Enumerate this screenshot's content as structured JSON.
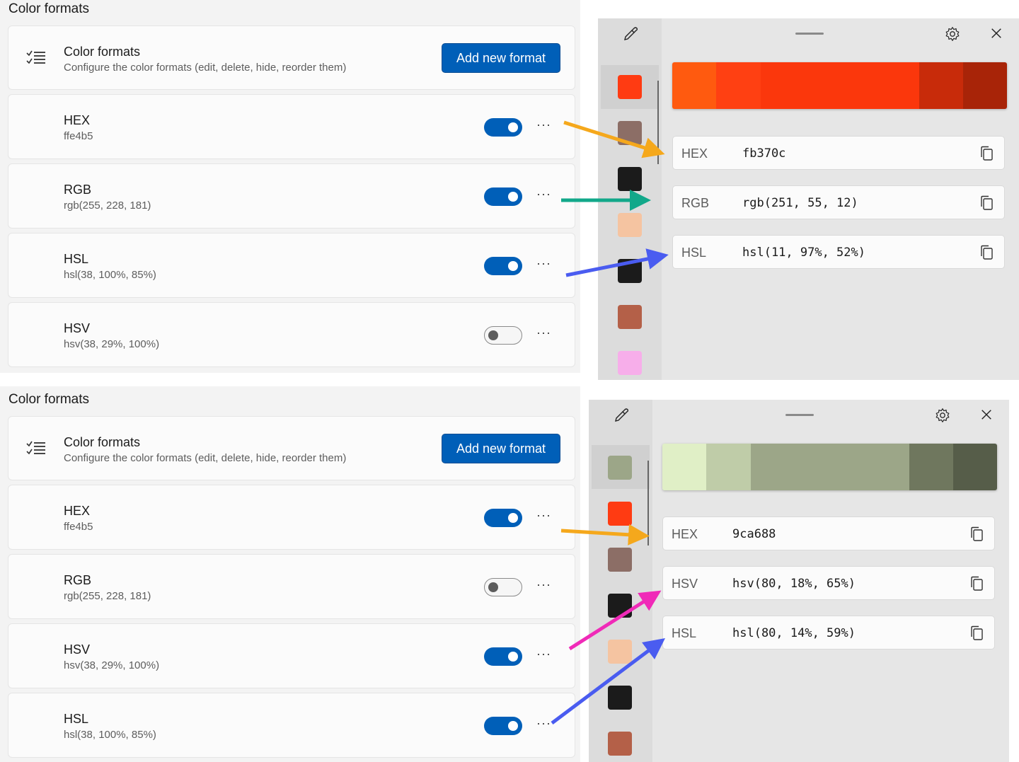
{
  "top": {
    "panel_title": "Color formats",
    "header": {
      "title": "Color formats",
      "subtitle": "Configure the color formats (edit, delete, hide, reorder them)",
      "add_button": "Add new format"
    },
    "formats": [
      {
        "name": "HEX",
        "value": "ffe4b5",
        "enabled": true
      },
      {
        "name": "RGB",
        "value": "rgb(255, 228, 181)",
        "enabled": true
      },
      {
        "name": "HSL",
        "value": "hsl(38, 100%, 85%)",
        "enabled": true
      },
      {
        "name": "HSV",
        "value": "hsv(38, 29%, 100%)",
        "enabled": false
      }
    ],
    "more_label": "···",
    "picker": {
      "history_colors": [
        "#ff3b12",
        "#8c6e66",
        "#1b1b1b",
        "#f5c4a1",
        "#1b1b1b",
        "#b46048",
        "#f7aeea"
      ],
      "gradient": [
        "#ff5a0f",
        "#ff4012",
        "#fb370c",
        "#fb370c",
        "#fb370c",
        "#c82b0a",
        "#a82408"
      ],
      "rows": [
        {
          "name": "HEX",
          "value": "fb370c"
        },
        {
          "name": "RGB",
          "value": "rgb(251, 55, 12)"
        },
        {
          "name": "HSL",
          "value": "hsl(11, 97%, 52%)"
        }
      ]
    }
  },
  "bottom": {
    "panel_title": "Color formats",
    "header": {
      "title": "Color formats",
      "subtitle": "Configure the color formats (edit, delete, hide, reorder them)",
      "add_button": "Add new format"
    },
    "formats": [
      {
        "name": "HEX",
        "value": "ffe4b5",
        "enabled": true
      },
      {
        "name": "RGB",
        "value": "rgb(255, 228, 181)",
        "enabled": false
      },
      {
        "name": "HSV",
        "value": "hsv(38, 29%, 100%)",
        "enabled": true
      },
      {
        "name": "HSL",
        "value": "hsl(38, 100%, 85%)",
        "enabled": true
      }
    ],
    "more_label": "···",
    "picker": {
      "history_colors": [
        "#9ca688",
        "#ff3b12",
        "#8c6e66",
        "#1b1b1b",
        "#f5c4a1",
        "#1b1b1b",
        "#b46048"
      ],
      "gradient": [
        "#e0efc6",
        "#bfcca8",
        "#9ca688",
        "#9ca688",
        "#9ca688",
        "#6f775e",
        "#565d49"
      ],
      "rows": [
        {
          "name": "HEX",
          "value": "9ca688"
        },
        {
          "name": "HSV",
          "value": "hsv(80, 18%, 65%)"
        },
        {
          "name": "HSL",
          "value": "hsl(80, 14%, 59%)"
        }
      ]
    }
  },
  "colors": {
    "accent": "#005fb8",
    "arrow_hex": "#f5a81c",
    "arrow_rgb": "#12a88a",
    "arrow_hsl": "#4a5cf0",
    "arrow_hsv": "#f02ab8"
  }
}
